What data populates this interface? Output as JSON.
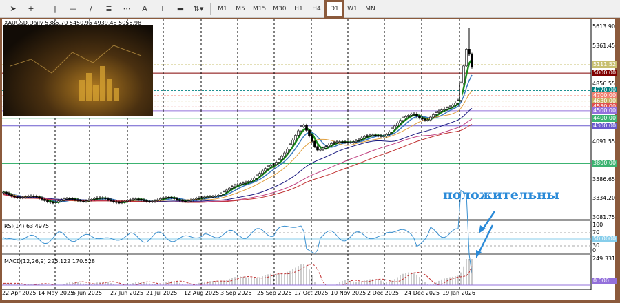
{
  "toolbar": {
    "tools": [
      "cursor-icon",
      "crosshair-icon",
      "vertical-line-icon",
      "horizontal-line-icon",
      "trendline-icon",
      "fibonacci-icon",
      "grid-icon",
      "text-icon",
      "text-label-icon",
      "rectangle-icon",
      "objects-menu-icon"
    ],
    "timeframes": [
      "M1",
      "M5",
      "M15",
      "M30",
      "H1",
      "H4",
      "D1",
      "W1",
      "MN"
    ],
    "active_timeframe": "D1"
  },
  "chart": {
    "symbol_info": "XAUUSD,Daily  5385.70 5450.95 4939.48 5056.98",
    "price_axis": [
      "5613.90",
      "5361.45",
      "4856.55",
      "4091.55",
      "3586.65",
      "3334.20",
      "3081.75"
    ],
    "levels": [
      {
        "v": "5111.52",
        "c": "#c8c070"
      },
      {
        "v": "5000.00",
        "c": "#800000"
      },
      {
        "v": "4770.00",
        "c": "#008080"
      },
      {
        "v": "4700.00",
        "c": "#f08070"
      },
      {
        "v": "4630.00",
        "c": "#c8b060"
      },
      {
        "v": "4550.00",
        "c": "#e05050"
      },
      {
        "v": "4500.00",
        "c": "#9370db"
      },
      {
        "v": "4400.00",
        "c": "#3cb371"
      },
      {
        "v": "4300.00",
        "c": "#6a5acd"
      },
      {
        "v": "3800.00",
        "c": "#3cb371"
      }
    ],
    "annotation": "положительны",
    "annotation_color": "#2a8ad8",
    "dates": [
      "22 Apr 2025",
      "14 May 2025",
      "5 Jun 2025",
      "27 Jun 2025",
      "21 Jul 2025",
      "12 Aug 2025",
      "3 Sep 2025",
      "25 Sep 2025",
      "17 Oct 2025",
      "10 Nov 2025",
      "2 Dec 2025",
      "24 Dec 2025",
      "19 Jan 2026"
    ]
  },
  "rsi": {
    "label": "RSI(14) 63.4975",
    "levels": [
      "100",
      "70",
      "50.0000",
      "30",
      "0"
    ]
  },
  "macd": {
    "label": "MACD(12,26,9) 225.122 170.528",
    "axis_top": "249.331",
    "zero": "0.000"
  },
  "chart_data": {
    "type": "candlestick",
    "symbol": "XAUUSD",
    "timeframe": "Daily",
    "ylim": [
      3081.75,
      5613.9
    ],
    "x": [
      "22 Apr 2025",
      "14 May 2025",
      "5 Jun 2025",
      "27 Jun 2025",
      "21 Jul 2025",
      "12 Aug 2025",
      "3 Sep 2025",
      "25 Sep 2025",
      "17 Oct 2025",
      "28 Oct 2025",
      "10 Nov 2025",
      "2 Dec 2025",
      "24 Dec 2025",
      "5 Jan 2026",
      "19 Jan 2026",
      "28 Jan 2026",
      "30 Jan 2026"
    ],
    "close": [
      3400,
      3300,
      3330,
      3300,
      3330,
      3320,
      3500,
      3780,
      4300,
      4000,
      4100,
      4190,
      4480,
      4370,
      4650,
      5350,
      5057
    ]
  }
}
